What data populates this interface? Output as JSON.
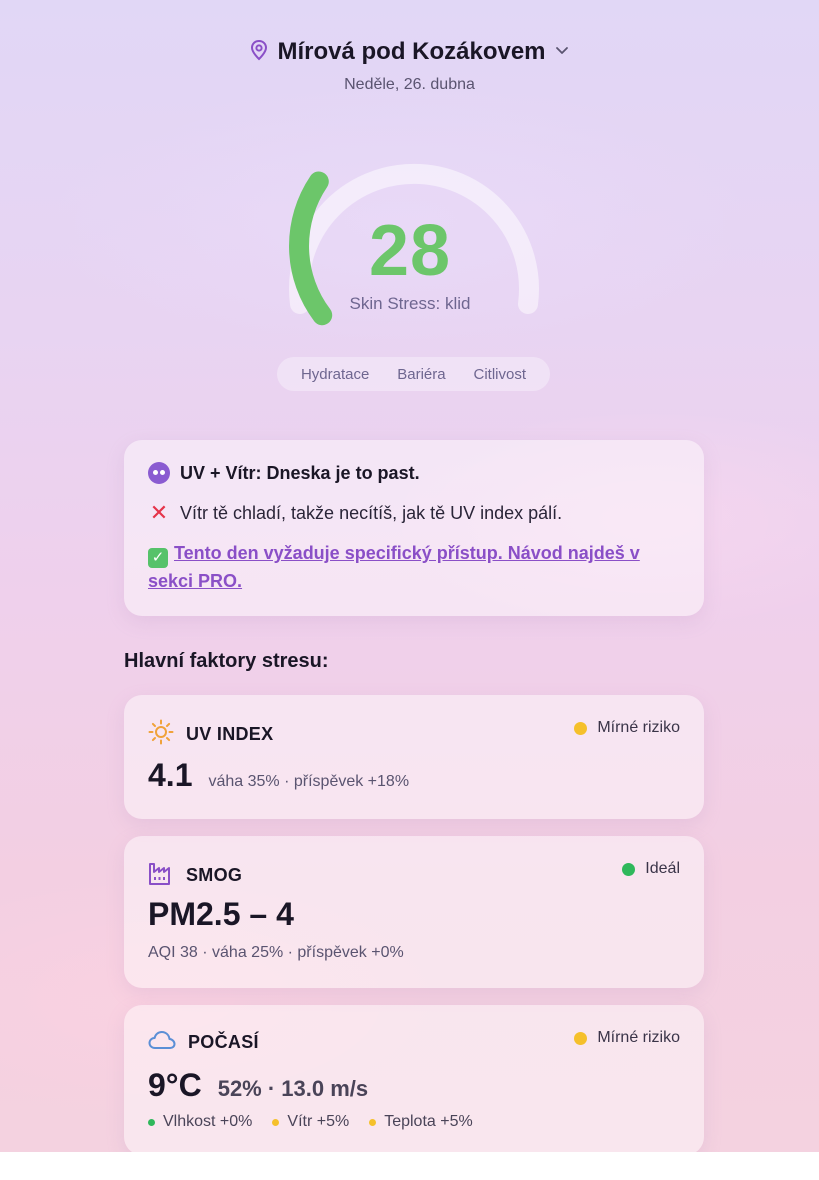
{
  "header": {
    "location": "Mírová pod Kozákovem",
    "date": "Neděle, 26. dubna",
    "location_icon": "map-pin-icon",
    "dropdown_icon": "chevron-down-icon"
  },
  "gauge": {
    "value": "28",
    "label": "Skin Stress: klid",
    "fill_fraction": 0.28,
    "color": "#6cc66a"
  },
  "tabs": [
    "Hydratace",
    "Bariéra",
    "Citlivost"
  ],
  "alert": {
    "title": "UV + Vítr: Dneska je to past.",
    "warning": "Vítr tě chladí, takže necítíš, jak tě UV index pálí.",
    "link_text": "Tento den vyžaduje specifický přístup. Návod najdeš v sekci PRO.",
    "link_color": "#8a4fc7"
  },
  "factors_title": "Hlavní faktory stresu:",
  "factors": {
    "uv": {
      "name": "UV INDEX",
      "icon": "sun-icon",
      "status": "Mírné riziko",
      "status_color": "#f5c02b",
      "value": "4.1",
      "meta": "váha 35% · příspěvek +18%"
    },
    "smog": {
      "name": "SMOG",
      "icon": "factory-icon",
      "status": "Ideál",
      "status_color": "#2fb85b",
      "value": "PM2.5 – 4",
      "meta": "AQI 38 · váha 25% · příspěvek +0%"
    },
    "weather": {
      "name": "POČASÍ",
      "icon": "cloud-icon",
      "status": "Mírné riziko",
      "status_color": "#f5c02b",
      "value": "9°C",
      "sub_value": "52% · 13.0 m/s",
      "items": [
        {
          "label": "Vlhkost +0%",
          "color": "#2fb85b"
        },
        {
          "label": "Vítr +5%",
          "color": "#f5c02b"
        },
        {
          "label": "Teplota +5%",
          "color": "#f5c02b"
        }
      ]
    }
  }
}
